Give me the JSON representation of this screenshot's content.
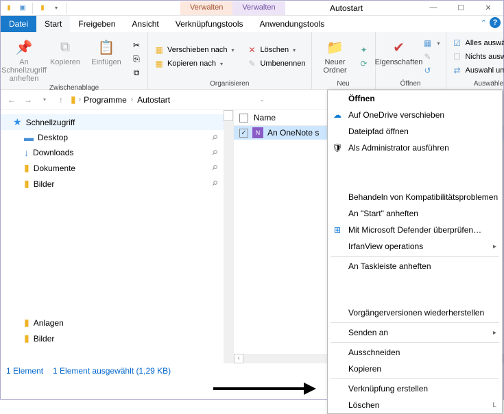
{
  "window": {
    "title": "Autostart"
  },
  "qat": {
    "manage1": "Verwalten",
    "manage2": "Verwalten"
  },
  "tabs": {
    "file": "Datei",
    "start": "Start",
    "share": "Freigeben",
    "view": "Ansicht",
    "linktools": "Verknüpfungstools",
    "apptools": "Anwendungstools"
  },
  "ribbon": {
    "clipboard": {
      "pin": "An Schnellzugriff anheften",
      "copy": "Kopieren",
      "paste": "Einfügen",
      "label": "Zwischenablage"
    },
    "organize": {
      "moveTo": "Verschieben nach",
      "copyTo": "Kopieren nach",
      "delete": "Löschen",
      "rename": "Umbenennen",
      "label": "Organisieren"
    },
    "new": {
      "newFolder": "Neuer Ordner",
      "label": "Neu"
    },
    "open": {
      "properties": "Eigenschaften",
      "label": "Öffnen"
    },
    "select": {
      "selectAll": "Alles auswählen",
      "selectNone": "Nichts auswählen",
      "invert": "Auswahl umkehren",
      "label": "Auswählen"
    }
  },
  "breadcrumb": {
    "seg1": "Programme",
    "seg2": "Autostart"
  },
  "nav": {
    "quick": "Schnellzugriff",
    "desktop": "Desktop",
    "downloads": "Downloads",
    "documents": "Dokumente",
    "pictures": "Bilder",
    "attachments": "Anlagen",
    "pictures2": "Bilder"
  },
  "content": {
    "colName": "Name",
    "file1": "An OneNote s"
  },
  "status": {
    "count": "1 Element",
    "selected": "1 Element ausgewählt (1,29 KB)"
  },
  "ctx": {
    "open": "Öffnen",
    "onedrive": "Auf OneDrive verschieben",
    "openPath": "Dateipfad öffnen",
    "runAdmin": "Als Administrator ausführen",
    "compat": "Behandeln von Kompatibilitätsproblemen",
    "pinStart": "An \"Start\" anheften",
    "defender": "Mit Microsoft Defender überprüfen…",
    "irfan": "IrfanView operations",
    "pinTask": "An Taskleiste anheften",
    "restore": "Vorgängerversionen wiederherstellen",
    "sendTo": "Senden an",
    "cut": "Ausschneiden",
    "copy": "Kopieren",
    "shortcut": "Verknüpfung erstellen",
    "delete": "Löschen"
  }
}
